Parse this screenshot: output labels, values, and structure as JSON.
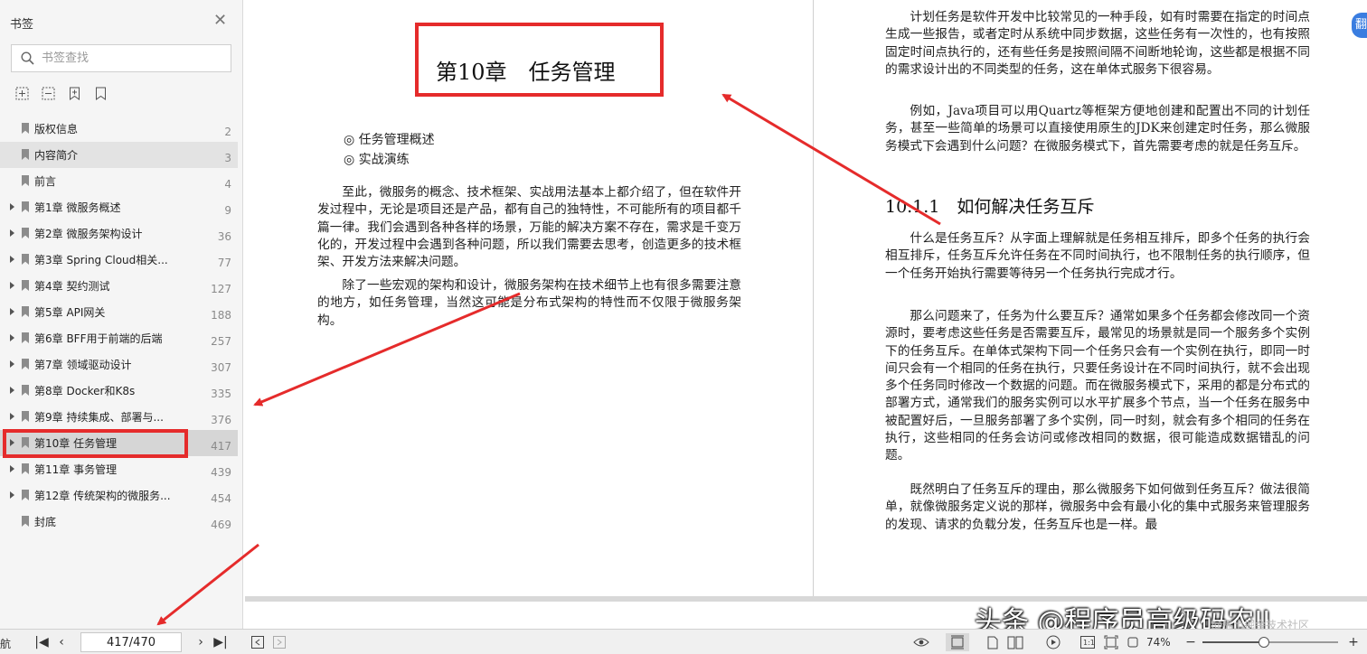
{
  "sidebar": {
    "title": "书签",
    "search_placeholder": "书签查找",
    "items": [
      {
        "label": "版权信息",
        "page": "2",
        "expandable": false
      },
      {
        "label": "内容简介",
        "page": "3",
        "expandable": false
      },
      {
        "label": "前言",
        "page": "4",
        "expandable": false
      },
      {
        "label": "第1章 微服务概述",
        "page": "9",
        "expandable": true
      },
      {
        "label": "第2章 微服务架构设计",
        "page": "36",
        "expandable": true
      },
      {
        "label": "第3章 Spring Cloud相关...",
        "page": "77",
        "expandable": true
      },
      {
        "label": "第4章 契约测试",
        "page": "127",
        "expandable": true
      },
      {
        "label": "第5章 API网关",
        "page": "188",
        "expandable": true
      },
      {
        "label": "第6章 BFF用于前端的后端",
        "page": "257",
        "expandable": true
      },
      {
        "label": "第7章 领域驱动设计",
        "page": "307",
        "expandable": true
      },
      {
        "label": "第8章 Docker和K8s",
        "page": "335",
        "expandable": true
      },
      {
        "label": "第9章 持续集成、部署与...",
        "page": "376",
        "expandable": true
      },
      {
        "label": "第10章 任务管理",
        "page": "417",
        "expandable": true
      },
      {
        "label": "第11章 事务管理",
        "page": "439",
        "expandable": true
      },
      {
        "label": "第12章 传统架构的微服务...",
        "page": "454",
        "expandable": true
      },
      {
        "label": "封底",
        "page": "469",
        "expandable": false
      }
    ]
  },
  "left_page": {
    "chapter_title": "第10章　任务管理",
    "toc": [
      "◎ 任务管理概述",
      "◎ 实战演练"
    ],
    "paragraphs": [
      "至此，微服务的概念、技术框架、实战用法基本上都介绍了，但在软件开发过程中，无论是项目还是产品，都有自己的独特性，不可能所有的项目都千篇一律。我们会遇到各种各样的场景，万能的解决方案不存在，需求是千变万化的，开发过程中会遇到各种问题，所以我们需要去思考，创造更多的技术框架、开发方法来解决问题。",
      "除了一些宏观的架构和设计，微服务架构在技术细节上也有很多需要注意的地方，如任务管理，当然这可能是分布式架构的特性而不仅限于微服务架构。"
    ]
  },
  "right_page": {
    "paragraphs_top": [
      "计划任务是软件开发中比较常见的一种手段，如有时需要在指定的时间点生成一些报告，或者定时从系统中同步数据，这些任务有一次性的，也有按照固定时间点执行的，还有些任务是按照间隔不间断地轮询，这些都是根据不同的需求设计出的不同类型的任务，这在单体式服务下很容易。",
      "例如，Java项目可以用Quartz等框架方便地创建和配置出不同的计划任务，甚至一些简单的场景可以直接使用原生的JDK来创建定时任务，那么微服务模式下会遇到什么问题？在微服务模式下，首先需要考虑的就是任务互斥。"
    ],
    "section_heading": "10.1.1　如何解决任务互斥",
    "paragraphs_bottom": [
      "什么是任务互斥？从字面上理解就是任务相互排斥，即多个任务的执行会相互排斥，任务互斥允许任务在不同时间执行，也不限制任务的执行顺序，但一个任务开始执行需要等待另一个任务执行完成才行。",
      "那么问题来了，任务为什么要互斥？通常如果多个任务都会修改同一个资源时，要考虑这些任务是否需要互斥，最常见的场景就是同一个服务多个实例下的任务互斥。在单体式架构下同一个任务只会有一个实例在执行，即同一时间只会有一个相同的任务在执行，只要任务设计在不同时间执行，就不会出现多个任务同时修改一个数据的问题。而在微服务模式下，采用的都是分布式的部署方式，通常我们的服务实例可以水平扩展多个节点，当一个任务在服务中被配置好后，一旦服务部署了多个实例，同一时刻，就会有多个相同的任务在执行，这些相同的任务会访问或修改相同的数据，很可能造成数据错乱的问题。",
      "既然明白了任务互斥的理由，那么微服务下如何做到任务互斥？做法很简单，就像微服务定义说的那样，微服务中会有最小化的集中式服务来管理服务的发现、请求的负载分发，任务互斥也是一样。最"
    ]
  },
  "watermark": {
    "text": "头条 @程序员高级码农II",
    "sub": "@稀土掘金技术社区"
  },
  "statusbar": {
    "nav_label": "航",
    "page_value": "417/470",
    "zoom": "74%",
    "zoom_fraction": 0.45
  },
  "colors": {
    "highlight_red": "#e52b2b",
    "accent_blue": "#3a7de0"
  },
  "icons": [
    "close-icon",
    "search-icon",
    "add-bookmark-icon",
    "add-sub-bookmark-icon",
    "bookmark-icon",
    "bookmark-outline-icon",
    "first-page-icon",
    "prev-page-icon",
    "next-page-icon",
    "last-page-icon",
    "back-icon",
    "forward-icon",
    "eye-icon",
    "single-page-icon",
    "double-page-icon",
    "play-icon",
    "fit-page-icon",
    "crop-icon",
    "square-icon",
    "zoom-out-icon",
    "zoom-in-icon"
  ]
}
